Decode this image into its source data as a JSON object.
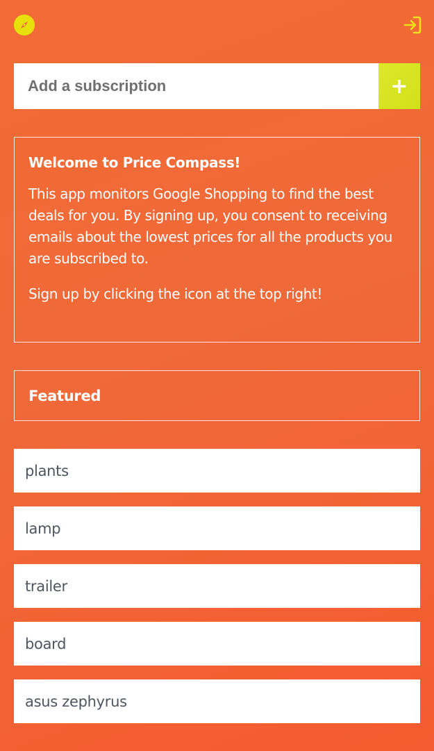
{
  "header": {
    "logo_icon": "compass-icon",
    "login_icon": "sign-in-icon",
    "accent_color": "#e8e00c"
  },
  "subscription": {
    "placeholder": "Add a subscription",
    "add_label": "+"
  },
  "welcome": {
    "title": "Welcome to Price Compass!",
    "body": "This app monitors Google Shopping to find the best deals for you. By signing up, you consent to receiving emails about the lowest prices for all the products you are subscribed to.",
    "signup_hint": "Sign up by clicking the icon at the top right!"
  },
  "featured": {
    "title": "Featured",
    "items": [
      {
        "label": "plants"
      },
      {
        "label": "lamp"
      },
      {
        "label": "trailer"
      },
      {
        "label": "board"
      },
      {
        "label": "asus zephyrus"
      }
    ]
  }
}
